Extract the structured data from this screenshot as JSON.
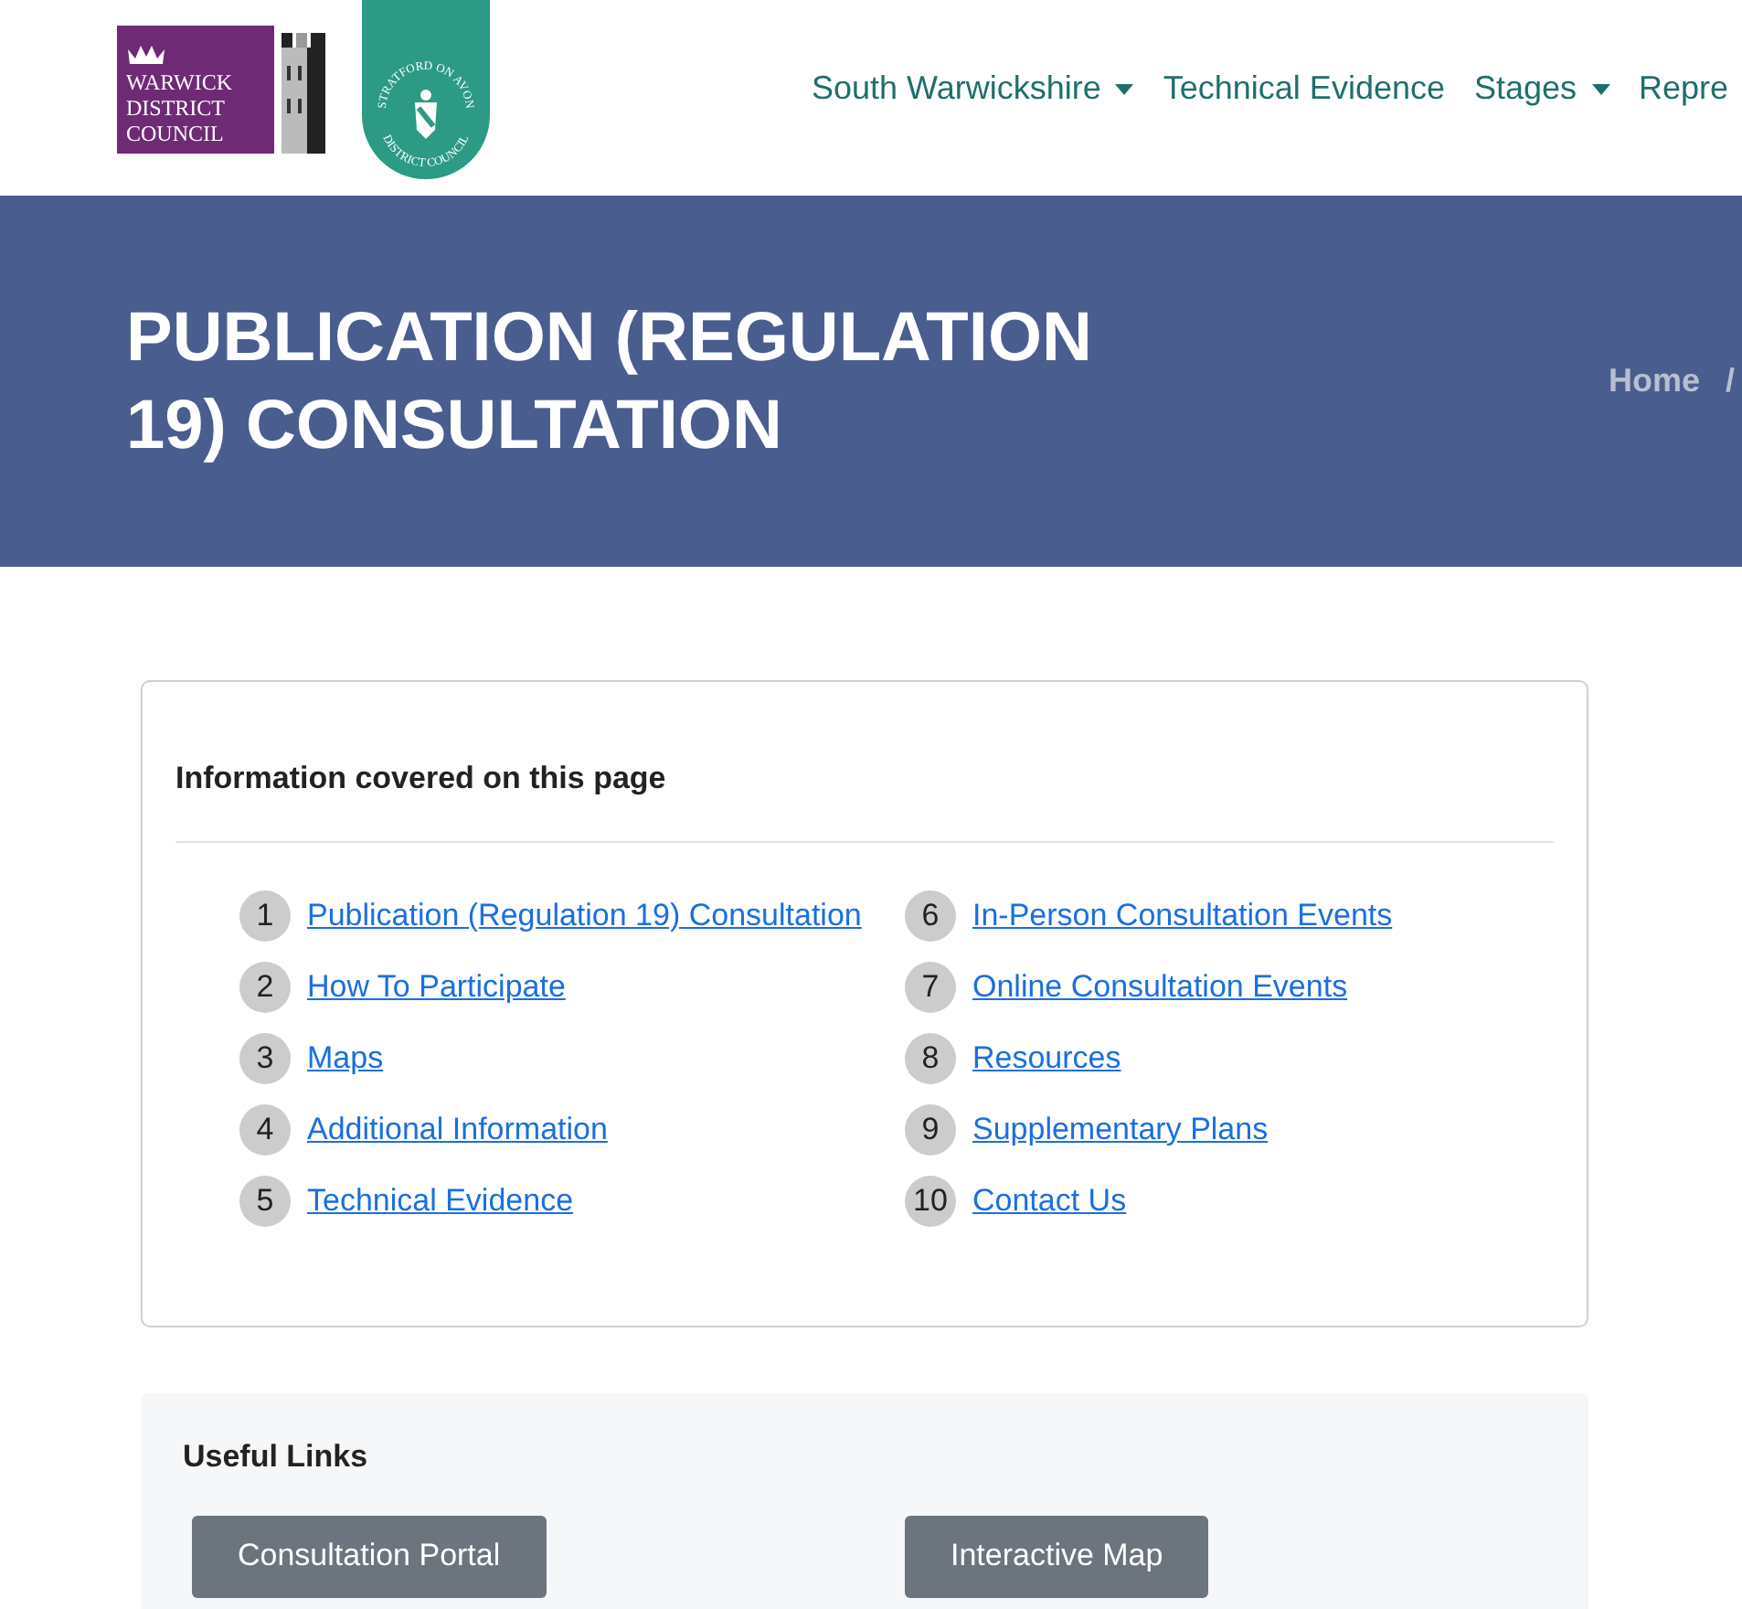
{
  "header": {
    "logos": [
      {
        "kind": "warwick",
        "lines": [
          "WARWICK",
          "DISTRICT",
          "COUNCIL"
        ]
      },
      {
        "kind": "stratford",
        "top_text": "STRATFORD ON AVON",
        "bottom_text": "DISTRICT COUNCIL"
      }
    ],
    "nav": [
      {
        "label": "South Warwickshire",
        "dropdown": true
      },
      {
        "label": "Technical Evidence",
        "dropdown": false
      },
      {
        "label": "Stages",
        "dropdown": true
      },
      {
        "label": "Repre",
        "dropdown": false
      }
    ]
  },
  "banner": {
    "title": "PUBLICATION (REGULATION 19) CONSULTATION",
    "breadcrumb": [
      "Home",
      "/"
    ]
  },
  "contents": {
    "heading": "Information covered on this page",
    "items": [
      {
        "number": "1",
        "label": "Publication (Regulation 19) Consultation"
      },
      {
        "number": "2",
        "label": "How To Participate"
      },
      {
        "number": "3",
        "label": "Maps"
      },
      {
        "number": "4",
        "label": "Additional Information"
      },
      {
        "number": "5",
        "label": "Technical Evidence"
      },
      {
        "number": "6",
        "label": "In-Person Consultation Events"
      },
      {
        "number": "7",
        "label": "Online Consultation Events"
      },
      {
        "number": "8",
        "label": "Resources"
      },
      {
        "number": "9",
        "label": "Supplementary Plans"
      },
      {
        "number": "10",
        "label": "Contact Us"
      }
    ]
  },
  "useful_links": {
    "heading": "Useful Links",
    "buttons": [
      "Consultation Portal",
      "Interactive Map"
    ]
  }
}
